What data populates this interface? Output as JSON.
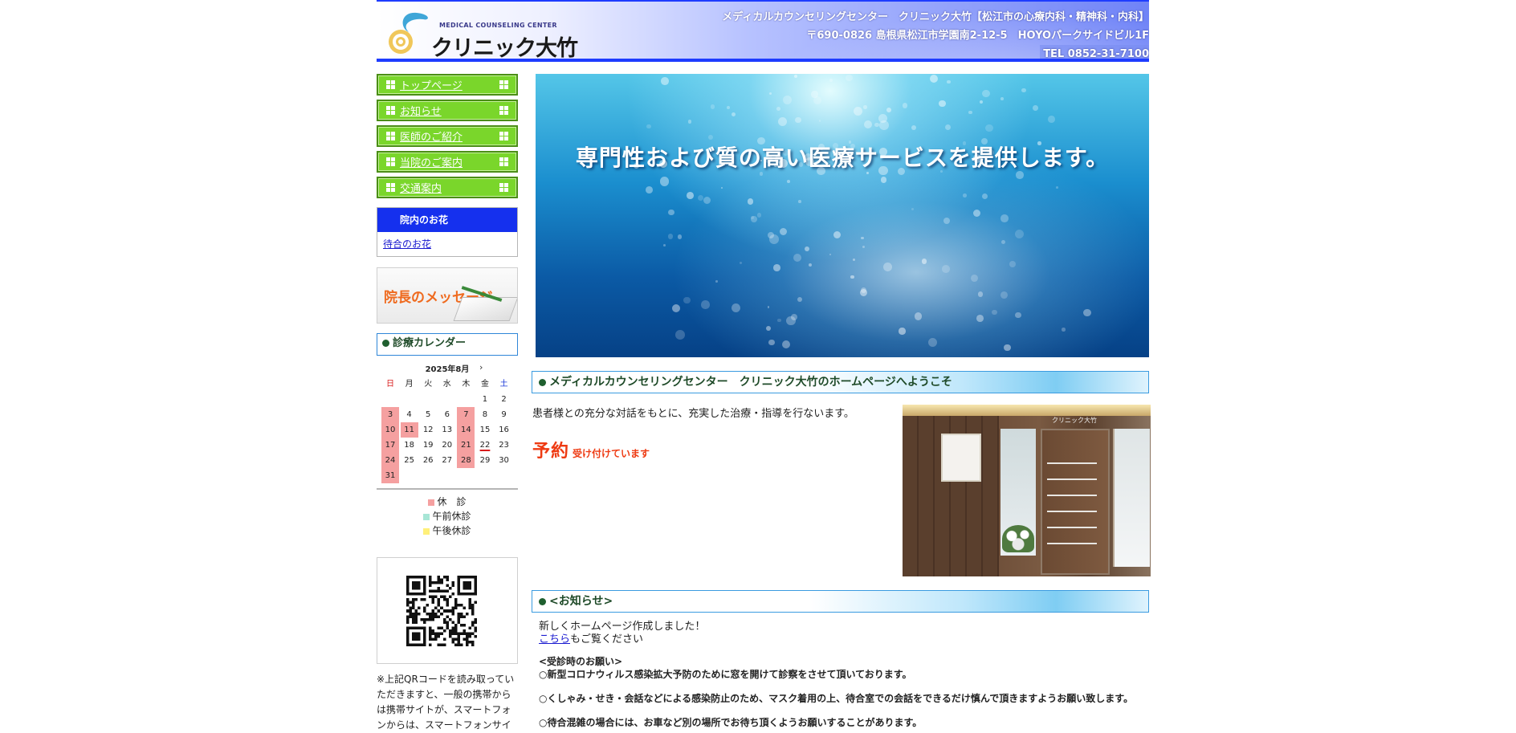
{
  "header": {
    "logo_sub": "MEDICAL COUNSELING CENTER",
    "logo_main": "クリニック大竹",
    "line1": "メディカルカウンセリングセンター　クリニック大竹【松江市の心療内科・精神科・内科】",
    "line2": "〒690-0826 島根県松江市学園南2-12-5　HOYOパークサイドビル1F",
    "line3": "TEL 0852-31-7100"
  },
  "nav": [
    {
      "label": "トップページ"
    },
    {
      "label": "お知らせ"
    },
    {
      "label": "医師のご紹介"
    },
    {
      "label": "当院のご案内"
    },
    {
      "label": "交通案内"
    }
  ],
  "flower": {
    "heading": "院内のお花",
    "link": "待合のお花"
  },
  "message_banner": "院長のメッセージ",
  "calendar": {
    "title": "診療カレンダー",
    "month": "2025年8月",
    "next": "›",
    "weekdays": [
      "日",
      "月",
      "火",
      "水",
      "木",
      "金",
      "土"
    ],
    "cells": [
      "",
      "",
      "",
      "",
      "",
      "1",
      "2",
      "3",
      "4",
      "5",
      "6",
      "7",
      "8",
      "9",
      "10",
      "11",
      "12",
      "13",
      "14",
      "15",
      "16",
      "17",
      "18",
      "19",
      "20",
      "21",
      "22",
      "23",
      "24",
      "25",
      "26",
      "27",
      "28",
      "29",
      "30",
      "31",
      "",
      "",
      "",
      "",
      "",
      ""
    ],
    "closed_days": [
      "3",
      "7",
      "10",
      "11",
      "14",
      "17",
      "21",
      "24",
      "28",
      "31"
    ],
    "today": "22",
    "legend": {
      "closed": "休　診",
      "am_closed": "午前休診",
      "pm_closed": "午後休診"
    },
    "colors": {
      "closed": "#f5a0a0",
      "am_closed": "#a8e6d6",
      "pm_closed": "#fff07a"
    }
  },
  "qr_note": "※上記QRコードを読み取っていただきますと、一般の携帯からは携帯サイトが、スマートフォンからは、スマートフォンサイ",
  "hero": {
    "text": "専門性および質の高い医療サービスを提供します。"
  },
  "welcome": {
    "title": "メディカルカウンセリングセンター　クリニック大竹のホームページへようこそ",
    "intro": "患者様との充分な対話をもとに、充実した治療・指導を行ないます。",
    "reservation_big": "予約",
    "reservation_small": "受け付けています",
    "photo_sign": "クリニック大竹"
  },
  "news": {
    "title": "<お知らせ>",
    "line1": "新しくホームページ作成しました！",
    "link": "こちら",
    "line2_rest": "もご覧ください",
    "req_title": "<受診時のお願い>",
    "req1": "○新型コロナウィルス感染拡大予防のために窓を開けて診察をさせて頂いております。",
    "req2": "○くしゃみ・せき・会話などによる感染防止のため、マスク着用の上、待合室での会話をできるだけ慎んで頂きますようお願い致します。",
    "req3": "○待合混雑の場合には、お車など別の場所でお待ち頂くようお願いすることがあります。"
  },
  "colors": {
    "header_blue": "#1e3cff",
    "nav_green": "#7ad62b",
    "accent_orange": "#ee3a12",
    "section_dot": "#1f5f2f"
  }
}
